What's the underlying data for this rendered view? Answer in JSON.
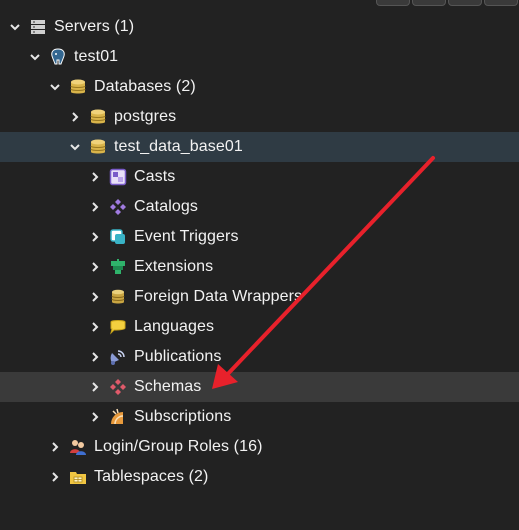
{
  "tree": {
    "servers": {
      "label": "Servers (1)",
      "icon": "servers-icon"
    },
    "server": {
      "label": "test01",
      "icon": "postgresql-elephant-icon"
    },
    "databases": {
      "label": "Databases (2)",
      "icon": "database-icon"
    },
    "db_postgres": {
      "label": "postgres",
      "icon": "database-icon"
    },
    "db_test": {
      "label": "test_data_base01",
      "icon": "database-icon"
    },
    "casts": {
      "label": "Casts",
      "icon": "casts-icon"
    },
    "catalogs": {
      "label": "Catalogs",
      "icon": "catalogs-icon"
    },
    "event_triggers": {
      "label": "Event Triggers",
      "icon": "event-trigger-icon"
    },
    "extensions": {
      "label": "Extensions",
      "icon": "extension-icon"
    },
    "fdw": {
      "label": "Foreign Data Wrappers",
      "icon": "foreign-data-wrapper-icon"
    },
    "languages": {
      "label": "Languages",
      "icon": "language-icon"
    },
    "publications": {
      "label": "Publications",
      "icon": "publication-icon"
    },
    "schemas": {
      "label": "Schemas",
      "icon": "schemas-icon"
    },
    "subscriptions": {
      "label": "Subscriptions",
      "icon": "subscription-icon"
    },
    "login_roles": {
      "label": "Login/Group Roles (16)",
      "icon": "users-icon"
    },
    "tablespaces": {
      "label": "Tablespaces (2)",
      "icon": "tablespace-folder-icon"
    }
  },
  "state": {
    "selected": "test_data_base01",
    "hovered": "Schemas"
  },
  "colors": {
    "background": "#222222",
    "selected_row": "#2f3b44",
    "hover_row": "#3a3a3a",
    "annotation_arrow": "#e8212b"
  }
}
